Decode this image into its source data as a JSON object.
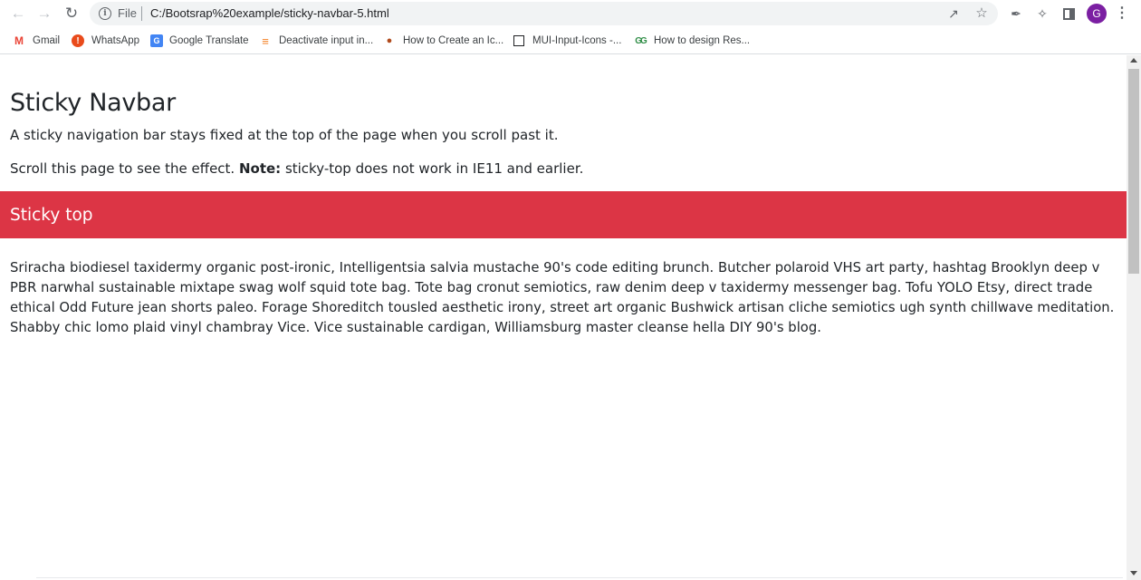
{
  "browser": {
    "scheme_label": "File",
    "url": "C:/Bootsrap%20example/sticky-navbar-5.html",
    "avatar_initial": "G",
    "icons": [
      "back-arrow-icon",
      "forward-arrow-icon",
      "reload-icon",
      "info-icon",
      "share-icon",
      "star-icon",
      "eyedropper-icon",
      "puzzle-icon",
      "side-panel-icon",
      "kebab-menu-icon"
    ]
  },
  "bookmarks": [
    {
      "label": "Gmail",
      "icon": "gmail-icon"
    },
    {
      "label": "WhatsApp",
      "icon": "whatsapp-icon"
    },
    {
      "label": "Google Translate",
      "icon": "translate-icon"
    },
    {
      "label": "Deactivate input in...",
      "icon": "stackoverflow-icon"
    },
    {
      "label": "How to Create an Ic...",
      "icon": "site-icon"
    },
    {
      "label": "MUI-Input-Icons -...",
      "icon": "mui-icon"
    },
    {
      "label": "How to design Res...",
      "icon": "gfg-icon"
    }
  ],
  "page": {
    "title": "Sticky Navbar",
    "lead": "A sticky navigation bar stays fixed at the top of the page when you scroll past it.",
    "note_prefix": "Scroll this page to see the effect. ",
    "note_bold": "Note:",
    "note_suffix": " sticky-top does not work in IE11 and earlier.",
    "sticky_label": "Sticky top",
    "sticky_color": "#dc3545",
    "body": "Sriracha biodiesel taxidermy organic post-ironic, Intelligentsia salvia mustache 90's code editing brunch. Butcher polaroid VHS art party, hashtag Brooklyn deep v PBR narwhal sustainable mixtape swag wolf squid tote bag. Tote bag cronut semiotics, raw denim deep v taxidermy messenger bag. Tofu YOLO Etsy, direct trade ethical Odd Future jean shorts paleo. Forage Shoreditch tousled aesthetic irony, street art organic Bushwick artisan cliche semiotics ugh synth chillwave meditation. Shabby chic lomo plaid vinyl chambray Vice. Vice sustainable cardigan, Williamsburg master cleanse hella DIY 90's blog."
  }
}
